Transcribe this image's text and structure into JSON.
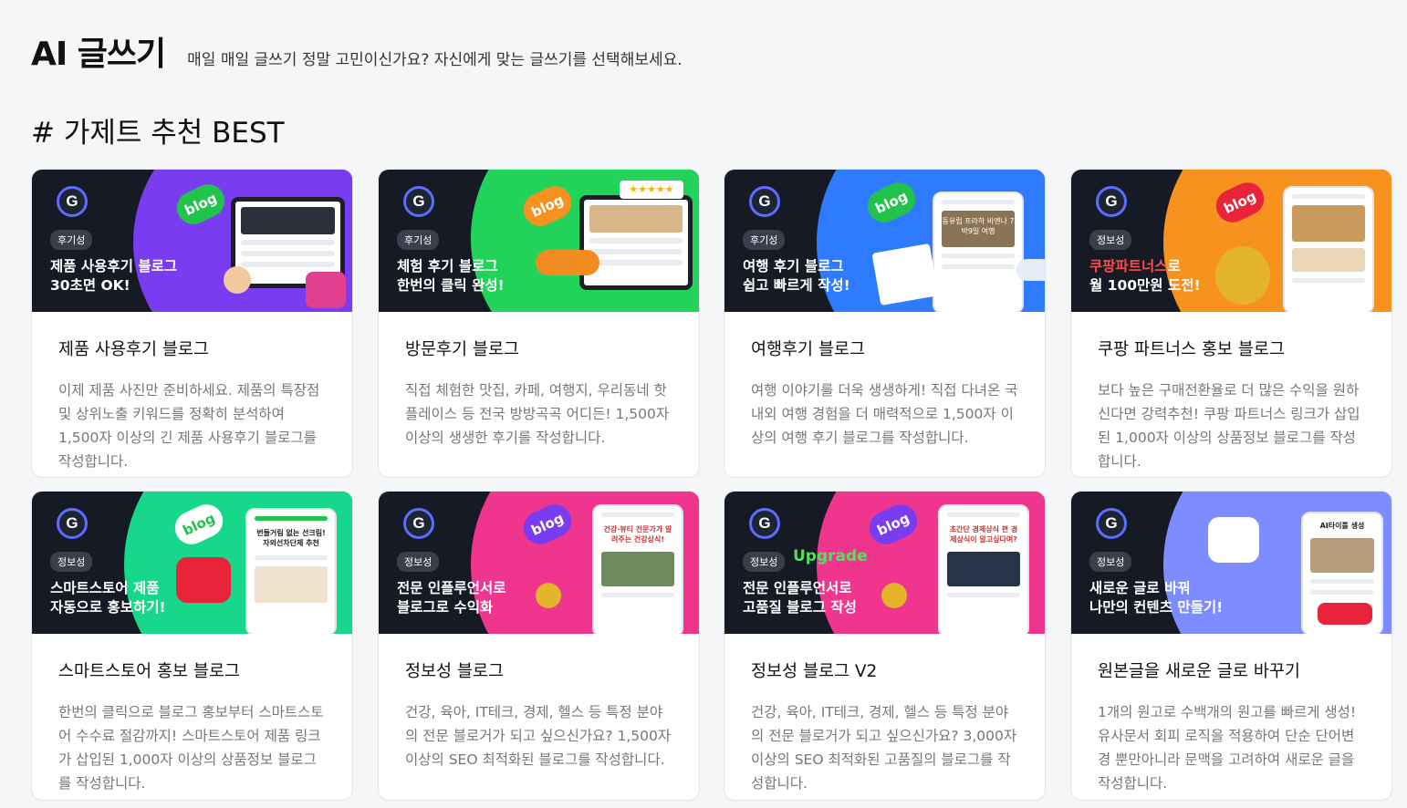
{
  "header": {
    "title": "AI 글쓰기",
    "subtitle": "매일 매일 글쓰기 정말 고민이신가요? 자신에게 맞는 글쓰기를 선택해보세요."
  },
  "section_title": "# 가제트 추천 BEST",
  "colors": {
    "accent_purple": "#7a3cf0",
    "accent_green": "#22d35a",
    "accent_blue": "#2f7bff",
    "accent_orange": "#f7921e",
    "accent_pink": "#f0358f",
    "banner_dark": "#161a25"
  },
  "cards": [
    {
      "badge": "후기성",
      "banner_line1": "제품 사용후기 블로그",
      "banner_line2": "30초면 OK!",
      "bubble": "blog",
      "title": "제품 사용후기 블로그",
      "desc": "이제 제품 사진만 준비하세요. 제품의 특장점 및 상위노출 키워드를 정확히 분석하여 1,500자 이상의 긴 제품 사용후기 블로그를 작성합니다."
    },
    {
      "badge": "후기성",
      "banner_line1": "체험 후기 블로그",
      "banner_line2": "한번의 클릭 완성!",
      "bubble": "blog",
      "title": "방문후기 블로그",
      "desc": "직접 체험한 맛집, 카페, 여행지, 우리동네 핫플레이스 등 전국 방방곡곡 어디든! 1,500자 이상의 생생한 후기를 작성합니다."
    },
    {
      "badge": "후기성",
      "banner_line1": "여행 후기 블로그",
      "banner_line2": "쉽고 빠르게 작성!",
      "bubble": "blog",
      "phone_text": "동유럽 프라하 비엔나 7박9일 여행",
      "title": "여행후기 블로그",
      "desc": "여행 이야기를 더욱 생생하게! 직접 다녀온 국내외 여행 경험을 더 매력적으로 1,500자 이상의 여행 후기 블로그를 작성합니다."
    },
    {
      "badge": "정보성",
      "banner_hl": "쿠팡파트너스",
      "banner_line1_rest": "로",
      "banner_line2": "월 100만원 도전!",
      "bubble": "blog",
      "title": "쿠팡 파트너스 홍보 블로그",
      "desc": "보다 높은 구매전환율로 더 많은 수익을 원하신다면 강력추천! 쿠팡 파트너스 링크가 삽입된 1,000자 이상의 상품정보 블로그를 작성합니다."
    },
    {
      "badge": "정보성",
      "banner_line1": "스마트스토어 제품",
      "banner_line2": "자동으로 홍보하기!",
      "bubble": "blog",
      "phone_text": "번들거림 없는 선크림! 자외선차단제 추천",
      "title": "스마트스토어 홍보 블로그",
      "desc": "한번의 클릭으로 블로그 홍보부터 스마트스토어 수수료 절감까지! 스마트스토어 제품 링크가 삽입된 1,000자 이상의 상품정보 블로그를 작성합니다."
    },
    {
      "badge": "정보성",
      "banner_line1": "전문 인플루언서로",
      "banner_line2": "블로그로 수익화",
      "bubble": "blog",
      "phone_text": "건강·뷰티 전문가가 알려주는 건강상식!",
      "title": "정보성 블로그",
      "desc": "건강, 육아, IT테크, 경제, 헬스 등 특정 분야의 전문 블로거가 되고 싶으신가요? 1,500자 이상의 SEO 최적화된 블로그를 작성합니다."
    },
    {
      "badge": "정보성",
      "upgrade": "Upgrade",
      "banner_line1": "전문 인플루언서로",
      "banner_line2": "고품질 블로그 작성",
      "bubble": "blog",
      "phone_text": "초간단 경제상식 편 경제상식이 알고싶다며?",
      "title": "정보성 블로그 V2",
      "desc": "건강, 육아, IT테크, 경제, 헬스 등 특정 분야의 전문 블로거가 되고 싶으신가요? 3,000자 이상의 SEO 최적화된 고품질의 블로그를 작성합니다."
    },
    {
      "badge": "정보성",
      "banner_line1": "새로운 글로 바꿔",
      "banner_line2": "나만의 컨텐츠 만들기!",
      "phone_text": "AI타이틀 생성",
      "title": "원본글을 새로운 글로 바꾸기",
      "desc": "1개의 원고로 수백개의 원고를 빠르게 생성! 유사문서 회피 로직을 적용하여 단순 단어변경 뿐만아니라 문맥을 고려하여 새로운 글을 작성합니다."
    }
  ]
}
